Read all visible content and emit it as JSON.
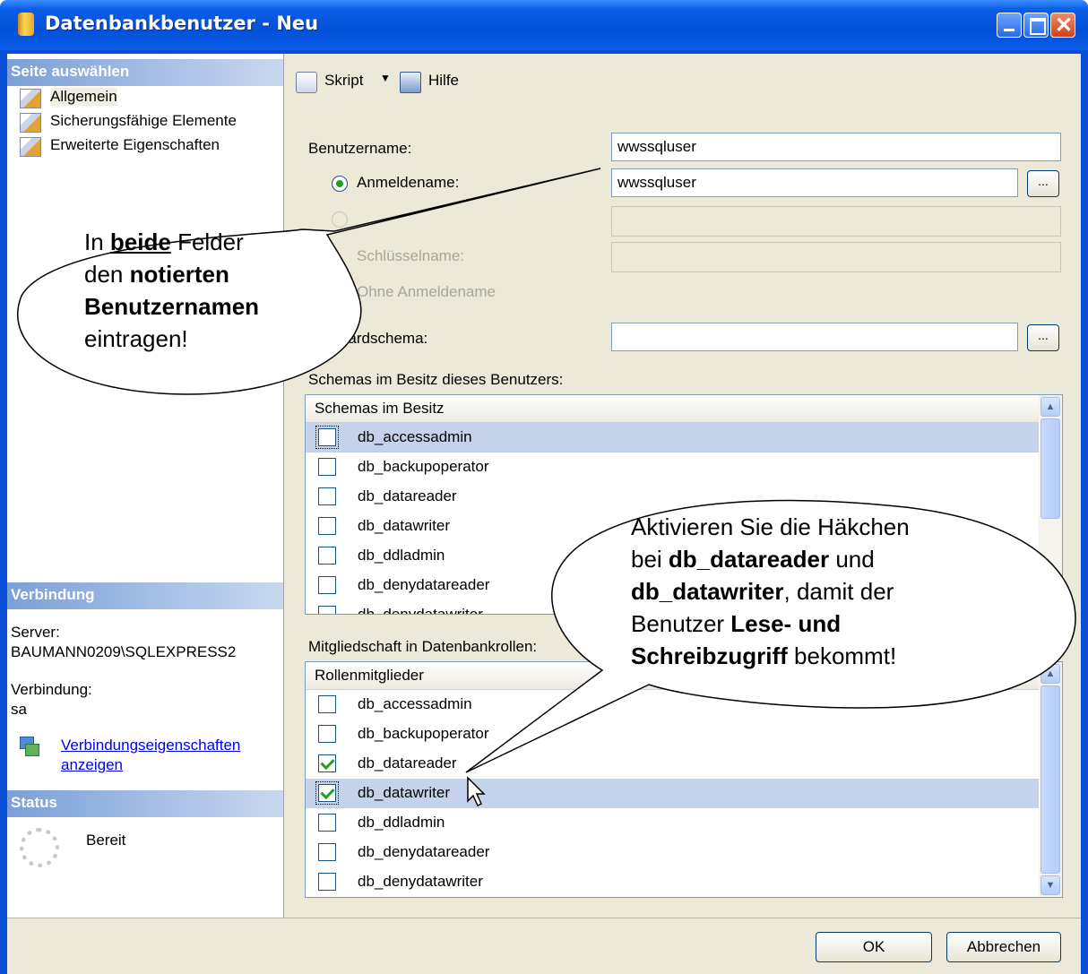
{
  "window": {
    "title": "Datenbankbenutzer - Neu"
  },
  "sidebar": {
    "select_page_header": "Seite auswählen",
    "items": [
      {
        "label": "Allgemein",
        "selected": true
      },
      {
        "label": "Sicherungsfähige Elemente"
      },
      {
        "label": "Erweiterte Eigenschaften"
      }
    ],
    "connection_header": "Verbindung",
    "server_label": "Server:",
    "server_value": "BAUMANN0209\\SQLEXPRESS2",
    "connection_label": "Verbindung:",
    "connection_value": "sa",
    "connection_link_line1": "Verbindungseigenschaften",
    "connection_link_line2": "anzeigen",
    "status_header": "Status",
    "status_value": "Bereit"
  },
  "toolbar": {
    "script_label": "Skript",
    "help_label": "Hilfe"
  },
  "form": {
    "username_label": "Benutzername:",
    "username_value": "wwssqluser",
    "login_label": "Anmeldename:",
    "login_value": "wwssqluser",
    "key_label": "Schlüsselname:",
    "no_login_label": "Ohne Anmeldename",
    "default_schema_label": "Standardschema:",
    "default_schema_value": "",
    "browse_label": "..."
  },
  "owned_schemas": {
    "section_label": "Schemas im Besitz dieses Benutzers:",
    "column_header": "Schemas im Besitz",
    "rows": [
      {
        "label": "db_accessadmin",
        "checked": false,
        "selected": true
      },
      {
        "label": "db_backupoperator",
        "checked": false
      },
      {
        "label": "db_datareader",
        "checked": false
      },
      {
        "label": "db_datawriter",
        "checked": false
      },
      {
        "label": "db_ddladmin",
        "checked": false
      },
      {
        "label": "db_denydatareader",
        "checked": false
      },
      {
        "label": "db_denydatawriter",
        "checked": false
      }
    ]
  },
  "role_membership": {
    "section_label": "Mitgliedschaft in Datenbankrollen:",
    "column_header": "Rollenmitglieder",
    "rows": [
      {
        "label": "db_accessadmin",
        "checked": false
      },
      {
        "label": "db_backupoperator",
        "checked": false
      },
      {
        "label": "db_datareader",
        "checked": true
      },
      {
        "label": "db_datawriter",
        "checked": true,
        "selected": true
      },
      {
        "label": "db_ddladmin",
        "checked": false
      },
      {
        "label": "db_denydatareader",
        "checked": false
      },
      {
        "label": "db_denydatawriter",
        "checked": false
      }
    ]
  },
  "footer": {
    "ok_label": "OK",
    "cancel_label": "Abbrechen"
  },
  "callout1": {
    "t1": "In ",
    "t2": "beide",
    "t3": " Felder",
    "t4": "den ",
    "t5": "notierten",
    "t6": "Benutzernamen",
    "t7": "eintragen!"
  },
  "callout2": {
    "l1": "Aktivieren Sie die Häkchen",
    "l2a": "bei ",
    "l2b": "db_datareader",
    "l2c": " und",
    "l3a": "db_datawriter",
    "l3b": ", damit der",
    "l4a": "Benutzer ",
    "l4b": "Lese- und",
    "l5a": "Schreibzugriff",
    "l5b": " bekommt!"
  },
  "colors": {
    "title_blue": "#0550d8",
    "selection": "#c4d3eb",
    "check_green": "#21a121"
  }
}
